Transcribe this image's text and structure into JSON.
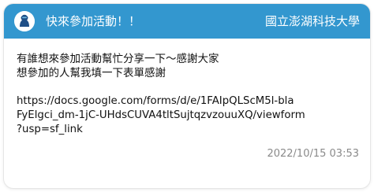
{
  "header": {
    "title": "快來參加活動！！",
    "school": "國立澎湖科技大學"
  },
  "post": {
    "lines": [
      "有誰想來參加活動幫忙分享一下～感謝大家",
      "想參加的人幫我填一下表單感謝"
    ],
    "link_lines": [
      "https://docs.google.com/forms/d/e/1FAIpQLScM5l-bla",
      "FyElgci_dm-1jC-UHdsCUVA4tltSujtqzvzouuXQ/viewform",
      "?usp=sf_link"
    ],
    "timestamp": "2022/10/15 03:53"
  },
  "colors": {
    "header_bg": "#3397cf",
    "header_text": "#ffffff",
    "timestamp": "#8a8a8a"
  },
  "icons": {
    "avatar": "anonymous-user-icon"
  }
}
